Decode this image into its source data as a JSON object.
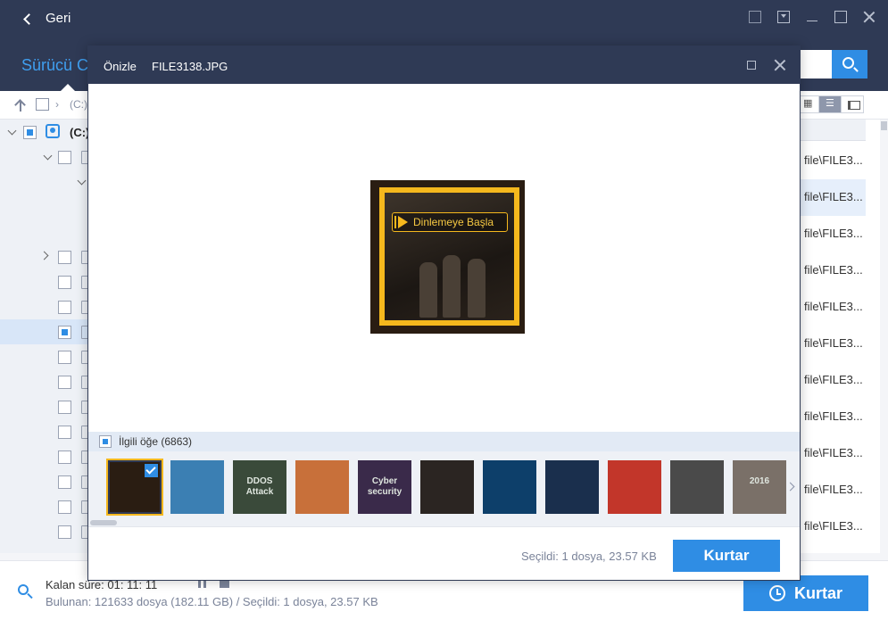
{
  "titlebar": {
    "back_label": "Geri"
  },
  "subheader": {
    "title": "Sürücü C"
  },
  "pathbar": {
    "crumb": "(C:)",
    "separator": "›"
  },
  "tree": {
    "drive_label": "(C:)"
  },
  "file_list": {
    "cells": [
      "file\\FILE3...",
      "file\\FILE3...",
      "file\\FILE3...",
      "file\\FILE3...",
      "file\\FILE3...",
      "file\\FILE3...",
      "file\\FILE3...",
      "file\\FILE3...",
      "file\\FILE3...",
      "file\\FILE3...",
      "file\\FILE3..."
    ],
    "selected_index": 1
  },
  "bottombar": {
    "remaining": "Kalan süre: 01: 11: 11",
    "found": "Bulunan: 121633 dosya (182.11 GB) / Seçildi: 1 dosya, 23.57 KB",
    "recover_label": "Kurtar"
  },
  "dialog": {
    "title": "Önizle",
    "filename": "FILE3138.JPG",
    "preview_banner": "Dinlemeye Başla",
    "related_label": "İlgili öğe (6863)",
    "selected_info": "Seçildi: 1 dosya, 23.57 KB",
    "recover_label": "Kurtar",
    "thumbnails": [
      {
        "name": "thumb-1",
        "text": "",
        "bg": "#2a1d12",
        "selected": true
      },
      {
        "name": "thumb-2",
        "text": "",
        "bg": "#3b7fb3"
      },
      {
        "name": "thumb-3",
        "text": "DDOS Attack",
        "bg": "#3a4a3a"
      },
      {
        "name": "thumb-4",
        "text": "",
        "bg": "#c8703a"
      },
      {
        "name": "thumb-5",
        "text": "Cyber security",
        "bg": "#3a2a4a"
      },
      {
        "name": "thumb-6",
        "text": "",
        "bg": "#2b2522"
      },
      {
        "name": "thumb-7",
        "text": "",
        "bg": "#0d3f6a"
      },
      {
        "name": "thumb-8",
        "text": "",
        "bg": "#1a2f4d"
      },
      {
        "name": "thumb-9",
        "text": "",
        "bg": "#c2362a"
      },
      {
        "name": "thumb-10",
        "text": "",
        "bg": "#4a4a4a"
      },
      {
        "name": "thumb-11",
        "text": "2016",
        "bg": "#7a7068"
      }
    ]
  },
  "colors": {
    "accent": "#2f8de4",
    "header": "#2f3a55",
    "highlight": "#f5b81d"
  }
}
